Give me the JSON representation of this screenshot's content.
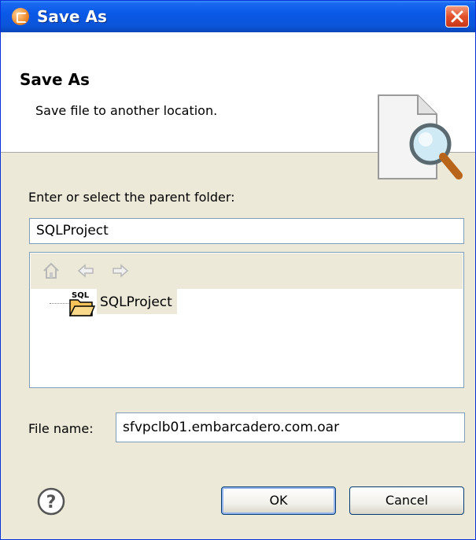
{
  "window": {
    "title": "Save As"
  },
  "banner": {
    "title": "Save As",
    "description": "Save file to another location."
  },
  "folder": {
    "label": "Enter or select the parent folder:",
    "value": "SQLProject"
  },
  "tree": {
    "items": [
      {
        "label": "SQLProject",
        "badge": "SQL"
      }
    ]
  },
  "file": {
    "label": "File name:",
    "value": "sfvpclb01.embarcadero.com.oar"
  },
  "buttons": {
    "ok": "OK",
    "cancel": "Cancel"
  },
  "colors": {
    "titlebar": "#0a58e8",
    "dialog_bg": "#ece9d8",
    "close": "#e2502a"
  }
}
